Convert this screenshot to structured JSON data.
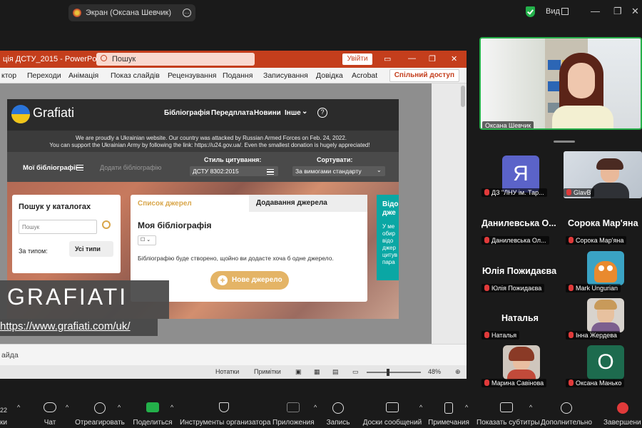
{
  "zoom_window": {
    "screen_tab_label": "Экран (Оксана Шевчик)",
    "view_label": "Вид"
  },
  "powerpoint": {
    "title_fragment": "ція ДСТУ_2015 - PowerPoint",
    "search_placeholder": "Пошук",
    "signin_label": "Увійти",
    "ribbon_tabs": [
      "ктор",
      "Переходи",
      "Анімація",
      "Показ слайдів",
      "Рецензування",
      "Подання",
      "Записування",
      "Довідка",
      "Acrobat"
    ],
    "share_label": "Спільний доступ",
    "notes_hint": "айда",
    "status": {
      "notes_label": "Нотатки",
      "comments_label": "Примітки",
      "zoom": "48%"
    }
  },
  "slide": {
    "website": {
      "logo": "Grafiati",
      "nav": [
        "Бібліографія",
        "Передплата",
        "Новини",
        "Інше"
      ],
      "banner_line1": "We are proudly a Ukrainian website. Our country was attacked by Russian Armed Forces on Feb. 24, 2022.",
      "banner_line2": "You can support the Ukrainian Army by following the link: https://u24.gov.ua/. Even the smallest donation is hugely appreciated!",
      "my_bibs": "Мої бібліографії",
      "add_bib": "Додати бібліографію",
      "style_label": "Стиль цитування:",
      "style_value": "ДСТУ 8302:2015",
      "sort_label": "Сортувати:",
      "sort_value": "За вимогами стандарту",
      "search_title": "Пошук у каталогах",
      "search_placeholder": "Пошук",
      "type_label": "За типом:",
      "type_value": "Усі типи",
      "tab_sources": "Список джерел",
      "tab_add": "Додавання джерела",
      "bib_title": "Моя бібліографія",
      "empty_msg": "Бібліографію буде створено, щойно ви додасте хоча б одне джерело.",
      "new_source": "Нове джерело",
      "teal_title": "Відо\nдже",
      "teal_text": "У ме\nобир\nвідо\nджер\nцитув\nпара"
    },
    "caption": "GRAFIATI",
    "url": "https://www.grafiati.com/uk/"
  },
  "participants": {
    "speaker_name": "Оксана Шевчик",
    "tiles": [
      {
        "big": "",
        "name": "ДЗ \"ЛНУ ім. Тар...",
        "avatar_letter": "Я",
        "avatar_color": "#5b63c9"
      },
      {
        "big": "",
        "name": "GlavB",
        "avatar_letter": "",
        "avatar_color": ""
      },
      {
        "big": "Данилевська О...",
        "name": "Данилевська Ол...",
        "avatar_letter": "",
        "avatar_color": ""
      },
      {
        "big": "Сорока Мар'яна",
        "name": "Сорока Мар'яна",
        "avatar_letter": "",
        "avatar_color": ""
      },
      {
        "big": "Юлія Пожидаєва",
        "name": "Юлія Пожидаєва",
        "avatar_letter": "",
        "avatar_color": ""
      },
      {
        "big": "",
        "name": "Mark Ungurian",
        "avatar_letter": "",
        "avatar_color": ""
      },
      {
        "big": "Наталья",
        "name": "Наталья",
        "avatar_letter": "",
        "avatar_color": ""
      },
      {
        "big": "",
        "name": "Інна Жердева",
        "avatar_letter": "",
        "avatar_color": ""
      },
      {
        "big": "",
        "name": "Марина Савінова",
        "avatar_letter": "",
        "avatar_color": ""
      },
      {
        "big": "",
        "name": "Оксана Манько",
        "avatar_letter": "O",
        "avatar_color": "#1d6b4e"
      }
    ]
  },
  "toolbar": {
    "participants_count": "22",
    "participants_label": "ки",
    "chat": "Чат",
    "react": "Отреагировать",
    "share": "Поделиться",
    "host_tools": "Инструменты организатора",
    "apps": "Приложения",
    "record": "Запись",
    "whiteboards": "Доски сообщений",
    "notes": "Примечания",
    "captions": "Показать субтитры",
    "more": "Дополнительно",
    "end": "Завершени"
  },
  "colors": {
    "ppt_accent": "#c43e1c",
    "speaker_border": "#27b04a",
    "share_green": "#23b04a",
    "grafiati_gold": "#e4b466",
    "teal": "#0aa7a4"
  }
}
